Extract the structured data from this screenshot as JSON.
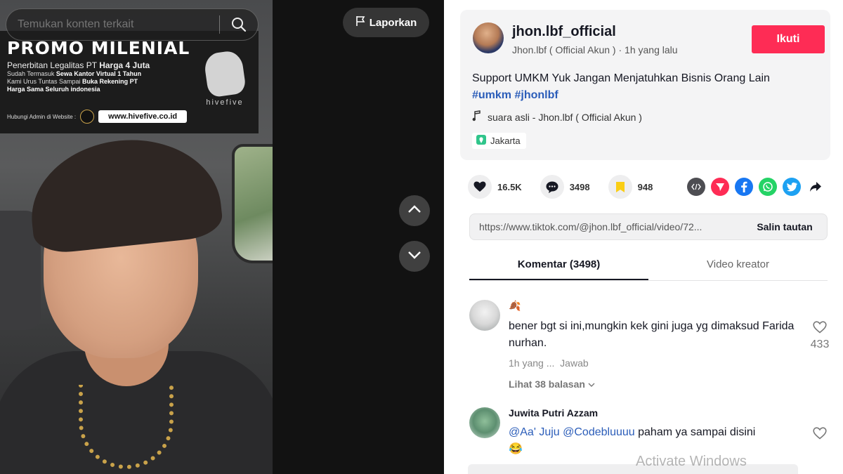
{
  "search": {
    "placeholder": "Temukan konten terkait"
  },
  "report": {
    "label": "Laporkan"
  },
  "promo": {
    "title": "PROMO MILENIAL",
    "subtitle_prefix": "Penerbitan Legalitas PT ",
    "subtitle_bold": "Harga 4 Juta",
    "line1_prefix": "Sudah Termasuk ",
    "line1_bold": "Sewa Kantor Virtual 1 Tahun",
    "line2_prefix": "Kami Urus Tuntas Sampai ",
    "line2_bold": "Buka Rekening PT",
    "line3": "Harga Sama Seluruh indonesia",
    "contact": "Hubungi Admin di Website :",
    "url": "www.hivefive.co.id",
    "logo_text": "hivefive"
  },
  "author": {
    "username": "jhon.lbf_official",
    "meta": "Jhon.lbf ( Official Akun ) · 1h yang lalu",
    "follow_label": "Ikuti"
  },
  "caption": {
    "text": "Support UMKM Yuk Jangan Menjatuhkan Bisnis Orang Lain",
    "hashtag1": "#umkm",
    "hashtag2": "#jhonlbf"
  },
  "music": {
    "label": "suara asli - Jhon.lbf ( Official Akun )"
  },
  "location": {
    "label": "Jakarta"
  },
  "stats": {
    "likes": "16.5K",
    "comments": "3498",
    "saves": "948"
  },
  "share": {
    "link": "https://www.tiktok.com/@jhon.lbf_official/video/72...",
    "copy_label": "Salin tautan"
  },
  "tabs": {
    "comments": "Komentar (3498)",
    "creator": "Video kreator"
  },
  "comments": [
    {
      "user": "🍂",
      "text": "bener bgt si ini,mungkin kek gini juga yg dimaksud Farida nurhan.",
      "time": "1h yang ...",
      "reply_label": "Jawab",
      "likes": "433",
      "replies": "Lihat 38 balasan"
    },
    {
      "user": "Juwita Putri Azzam",
      "mention1": "@Aa' Juju",
      "mention2": "@Codebluuuu",
      "text": "paham ya sampai disini",
      "emoji": "😂"
    }
  ],
  "watermark": "Activate Windows",
  "colors": {
    "accent": "#fe2c55",
    "link": "#2b5db9"
  }
}
